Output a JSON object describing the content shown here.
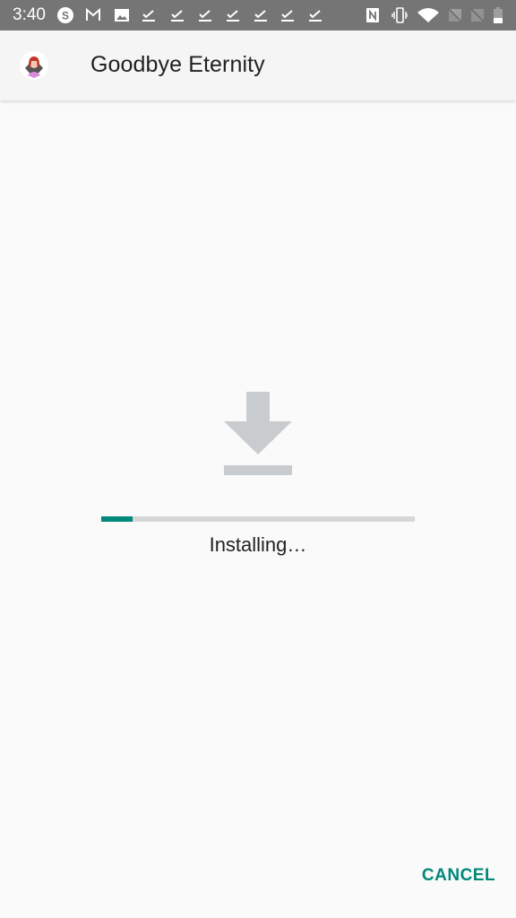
{
  "status_bar": {
    "time": "3:40",
    "left_icons": [
      "skype-icon",
      "gmail-icon",
      "image-icon",
      "download-done-icon",
      "download-done-icon",
      "download-done-icon",
      "download-done-icon",
      "download-done-icon",
      "download-done-icon",
      "download-done-icon"
    ],
    "right_icons": [
      "nfc-icon",
      "vibrate-icon",
      "wifi-icon",
      "no-signal-icon",
      "no-signal-icon",
      "battery-icon"
    ]
  },
  "app_bar": {
    "app_icon": "app-icon",
    "title": "Goodbye Eternity"
  },
  "main": {
    "icon": "download-icon",
    "progress_percent": 10,
    "status": "Installing…"
  },
  "actions": {
    "cancel_label": "CANCEL"
  },
  "colors": {
    "accent": "#00897b",
    "progress_track": "#d6d6d6",
    "status_bar": "#757575"
  }
}
